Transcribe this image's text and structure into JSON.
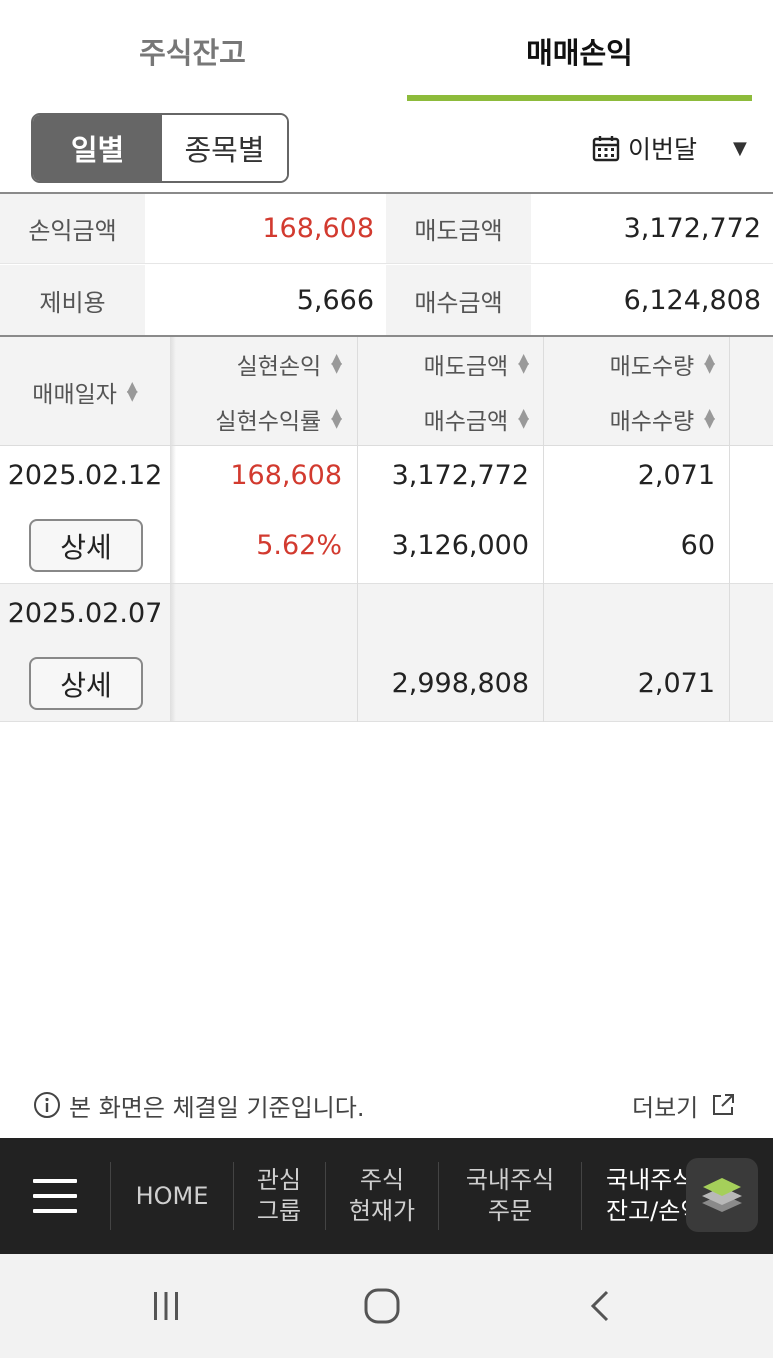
{
  "tabs": {
    "balance": "주식잔고",
    "pnl": "매매손익"
  },
  "view_toggle": {
    "daily": "일별",
    "by_stock": "종목별"
  },
  "period": {
    "label": "이번달",
    "caret": "▼"
  },
  "summary": {
    "pnl_label": "손익금액",
    "pnl_value": "168,608",
    "sell_amount_label": "매도금액",
    "sell_amount_value": "3,172,772",
    "fee_label": "제비용",
    "fee_value": "5,666",
    "buy_amount_label": "매수금액",
    "buy_amount_value": "6,124,808"
  },
  "table": {
    "headers": {
      "date": "매매일자",
      "realized_pnl": "실현손익",
      "realized_rate": "실현수익률",
      "sell_amount": "매도금액",
      "buy_amount": "매수금액",
      "sell_qty": "매도수량",
      "buy_qty": "매수수량"
    },
    "detail_label": "상세",
    "rows": [
      {
        "date": "2025.02.12",
        "realized_pnl": "168,608",
        "realized_rate": "5.62%",
        "sell_amount": "3,172,772",
        "buy_amount": "3,126,000",
        "sell_qty": "2,071",
        "buy_qty": "60"
      },
      {
        "date": "2025.02.07",
        "realized_pnl": "",
        "realized_rate": "",
        "sell_amount": "",
        "buy_amount": "2,998,808",
        "sell_qty": "",
        "buy_qty": "2,071"
      }
    ]
  },
  "footer": {
    "note": "본 화면은 체결일 기준입니다.",
    "more": "더보기"
  },
  "bottom_nav": {
    "home": "HOME",
    "watch_group_l1": "관심",
    "watch_group_l2": "그룹",
    "stock_price_l1": "주식",
    "stock_price_l2": "현재가",
    "domestic_order_l1": "국내주식",
    "domestic_order_l2": "주문",
    "domestic_balance_l1": "국내주식",
    "domestic_balance_l2": "잔고/손익"
  },
  "colors": {
    "accent": "#8dbb3b",
    "profit": "#d23a2f",
    "nav_bg": "#222222"
  },
  "icons": [
    "calendar-icon",
    "info-icon",
    "external-link-icon",
    "menu-icon",
    "layers-icon",
    "recent-apps-icon",
    "home-icon",
    "back-icon"
  ]
}
